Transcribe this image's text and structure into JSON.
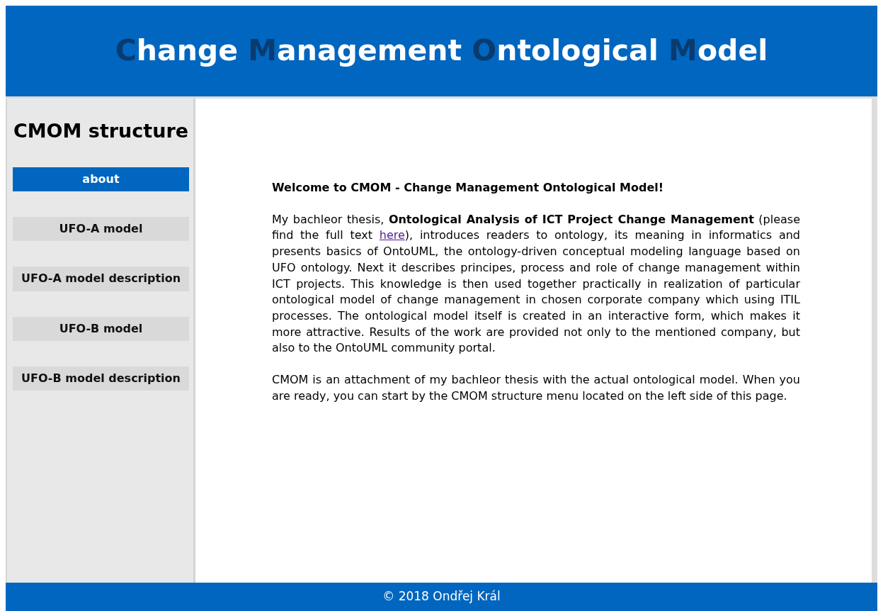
{
  "header": {
    "title_words": [
      {
        "initial": "C",
        "rest": "hange"
      },
      {
        "initial": "M",
        "rest": "anagement"
      },
      {
        "initial": "O",
        "rest": "ntological"
      },
      {
        "initial": "M",
        "rest": "odel"
      }
    ]
  },
  "sidebar": {
    "title": "CMOM structure",
    "items": [
      {
        "label": "about",
        "selected": true
      },
      {
        "label": "UFO-A model",
        "selected": false
      },
      {
        "label": "UFO-A model description",
        "selected": false
      },
      {
        "label": "UFO-B model",
        "selected": false
      },
      {
        "label": "UFO-B model description",
        "selected": false
      }
    ]
  },
  "content": {
    "heading": "Welcome to CMOM - Change Management Ontological Model!",
    "thesis_paragraph": {
      "before": "My bachleor thesis, **Ontological Analysis of ICT Project Change Management** (please find the full text ",
      "link": "here",
      "after": "), introduces readers to ontology, its meaning in informatics and presents basics of OntoUML, the ontology-driven conceptual modeling language based on UFO ontology. Next it describes principes, process and role of change management within ICT projects. This knowledge is then used together practically in realization of particular ontological model of change management in chosen corporate company which using ITIL processes. The ontological model itself is created in an interactive form, which makes it more attractive. Results of the work are provided not only to the mentioned company, but also to the OntoUML community portal."
    },
    "closing_paragraph": "CMOM is an attachment of my bachleor thesis with the actual ontological model. When you are ready, you can start by the CMOM structure menu located on the left side of this page."
  },
  "footer": {
    "text": "© 2018 Ondřej Král"
  }
}
